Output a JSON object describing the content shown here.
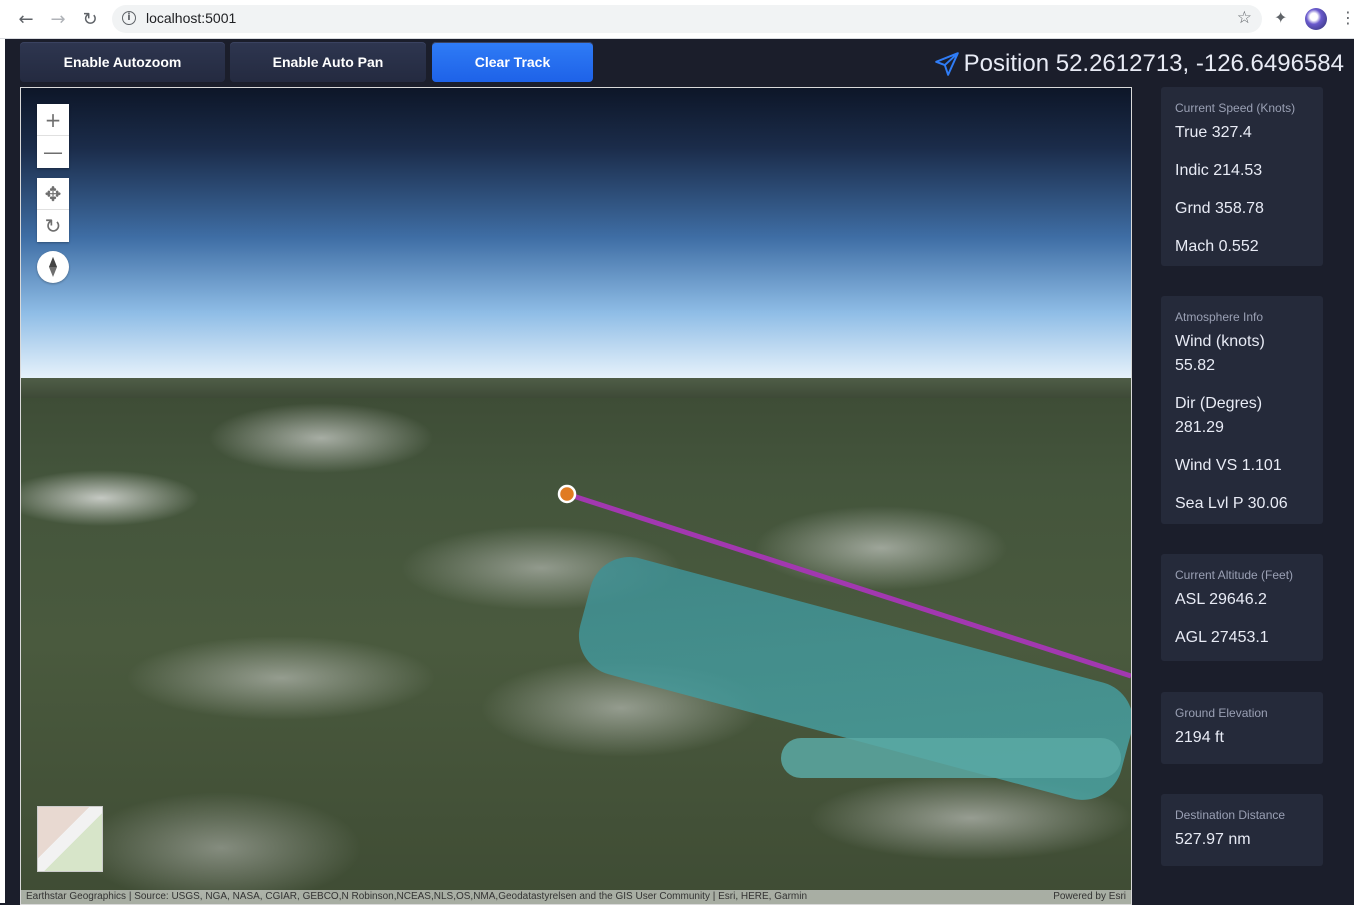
{
  "browser": {
    "url": "localhost:5001"
  },
  "toolbar": {
    "autozoom_label": "Enable Autozoom",
    "autopan_label": "Enable Auto Pan",
    "clear_label": "Clear Track",
    "position_text": "Position 52.2612713, -126.6496584"
  },
  "map": {
    "attribution_left": "Earthstar Geographics | Source: USGS, NGA, NASA, CGIAR, GEBCO,N Robinson,NCEAS,NLS,OS,NMA,Geodatastyrelsen and the GIS User Community | Esri, HERE, Garmin",
    "attribution_right": "Powered by Esri",
    "track_color": "#a238b0",
    "marker_color": "#e07b22"
  },
  "panels": {
    "speed": {
      "title": "Current Speed (Knots)",
      "rows": [
        "True 327.4",
        "Indic 214.53",
        "Grnd 358.78",
        "Mach 0.552"
      ]
    },
    "atmosphere": {
      "title": "Atmosphere Info",
      "rows": [
        "Wind (knots) 55.82",
        "Dir (Degres) 281.29",
        "Wind VS 1.101",
        "Sea Lvl P 30.06"
      ]
    },
    "altitude": {
      "title": "Current Altitude (Feet)",
      "rows": [
        "ASL 29646.2",
        "AGL 27453.1"
      ]
    },
    "ground": {
      "title": "Ground Elevation",
      "rows": [
        "2194 ft"
      ]
    },
    "destination": {
      "title": "Destination Distance",
      "rows": [
        "527.97 nm"
      ]
    }
  }
}
